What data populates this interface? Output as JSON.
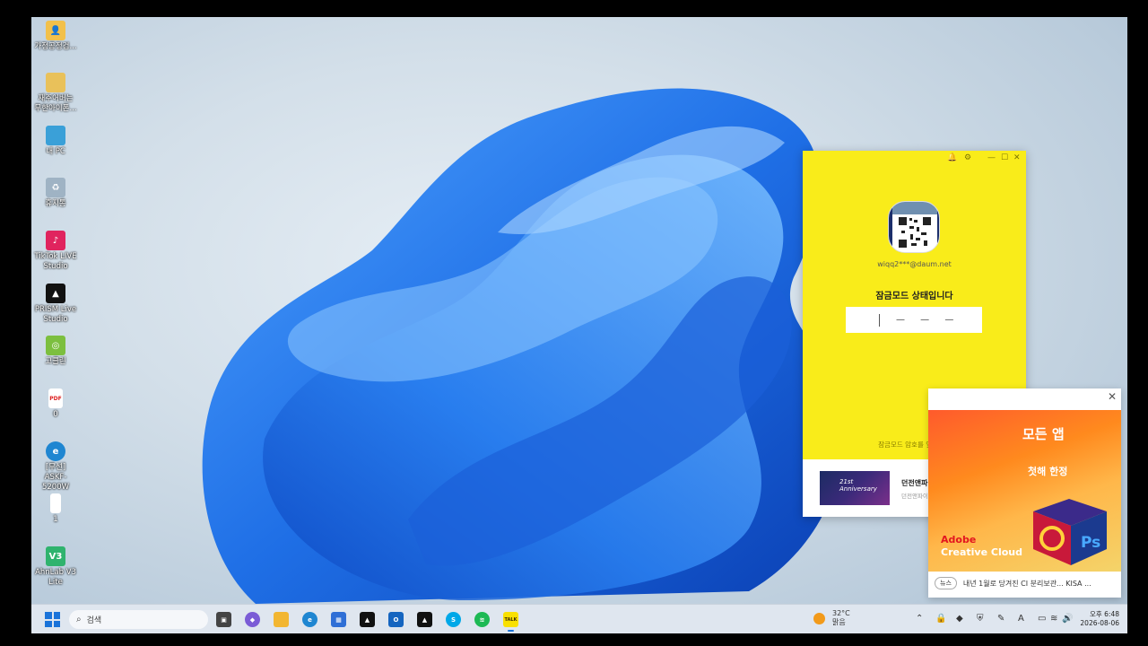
{
  "desktop_icons": [
    {
      "label": "가정공정검...",
      "icon": "user-folder-icon",
      "color": "#f2c04a"
    },
    {
      "label": "재주어버는\n무한아이폰...",
      "icon": "folder-icon",
      "color": "#e9c15a"
    },
    {
      "label": "내 PC",
      "icon": "monitor-icon",
      "color": "#3aa0d8"
    },
    {
      "label": "휴지통",
      "icon": "recycle-bin-icon",
      "color": "#9fb3c4"
    },
    {
      "label": "TikTok LIVE\nStudio",
      "icon": "tiktok-icon",
      "color": "#e0245e"
    },
    {
      "label": "PRISM Live\nStudio",
      "icon": "prism-icon",
      "color": "#111111"
    },
    {
      "label": "고클린",
      "icon": "goclean-icon",
      "color": "#7cbf3f"
    },
    {
      "label": "0",
      "icon": "pdf-file-icon",
      "color": "#ffffff"
    },
    {
      "label": "[무선]\nASKF-5200W",
      "icon": "edge-icon",
      "color": "#1f86d1"
    },
    {
      "label": "1",
      "icon": "blank-file-icon",
      "color": "#ffffff"
    },
    {
      "label": "AhnLab V3\nLite",
      "icon": "ahnlab-icon",
      "color": "#2fb36e"
    }
  ],
  "kakao": {
    "email": "wiqq2***@daum.net",
    "lock_message": "잠금모드 상태입니다",
    "pin_placeholder": "— — —",
    "forgot_link": "잠금모드 암호를 잊었어요",
    "ad_title": "던전앤파이터 21주년 업데이트",
    "ad_subtitle": "던전앤파이터",
    "ad_thumb_text": "21st Anniversary"
  },
  "adobe": {
    "headline": "모든 앱",
    "subline": "첫해 한정",
    "brand_line1": "Adobe",
    "brand_line2": "Creative Cloud",
    "news_tag": "뉴스",
    "news_text": "내년 1월로 당겨진 CI 분리보관... KISA ..."
  },
  "taskbar": {
    "search_placeholder": "검색",
    "temperature": "32°C",
    "weather": "맑음",
    "time": "오후 6:48",
    "date": "2026-08-06",
    "apps": [
      {
        "icon": "task-view-icon",
        "color": "#444444"
      },
      {
        "icon": "copilot-icon",
        "color": "#7b5cd6"
      },
      {
        "icon": "file-explorer-icon",
        "color": "#f2b632"
      },
      {
        "icon": "edge-icon",
        "color": "#1f86d1"
      },
      {
        "icon": "microsoft-store-icon",
        "color": "#2f6fd6"
      },
      {
        "icon": "prism-icon",
        "color": "#111111"
      },
      {
        "icon": "outlook-icon",
        "color": "#1565c0"
      },
      {
        "icon": "prism-live-icon",
        "color": "#111111"
      },
      {
        "icon": "skype-icon",
        "color": "#00a8e8"
      },
      {
        "icon": "spotify-icon",
        "color": "#1db954"
      },
      {
        "icon": "kakaotalk-icon",
        "color": "#f9e000",
        "label": "TALK"
      }
    ]
  }
}
